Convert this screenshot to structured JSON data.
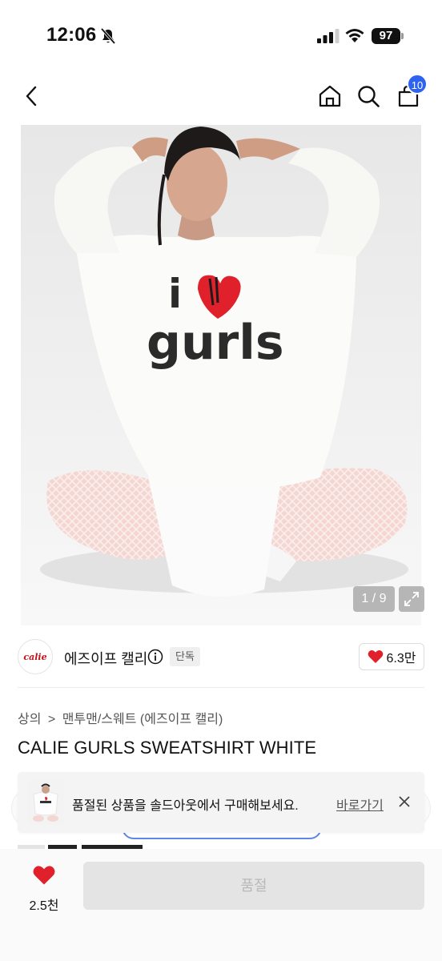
{
  "status_bar": {
    "time": "12:06",
    "battery": "97"
  },
  "nav": {
    "back_icon": "chevron-left-icon",
    "home_icon": "home-icon",
    "search_icon": "search-icon",
    "cart_icon": "shopping-bag-icon",
    "cart_count": "10",
    "accent_color": "#2d63ee"
  },
  "gallery": {
    "counter": "1 / 9",
    "expand_icon": "expand-icon",
    "shirt_print_top": "i",
    "shirt_print_bottom": "gurls"
  },
  "brand": {
    "logo_text": "calie",
    "name": "에즈이프 캘리",
    "badge": "단독",
    "likes": "6.3만",
    "heart_color": "#e0202a"
  },
  "product": {
    "breadcrumb_category": "상의",
    "breadcrumb_separator": ">",
    "breadcrumb_sub": "맨투맨/스웨트 (에즈이프 캘리)",
    "title": "CALIE GURLS SWEATSHIRT WHITE"
  },
  "toast": {
    "message": "품절된 상품을 솔드아웃에서 구매해보세요.",
    "link": "바로가기"
  },
  "bottom_bar": {
    "wish_count": "2.5천",
    "buy_label": "품절"
  }
}
